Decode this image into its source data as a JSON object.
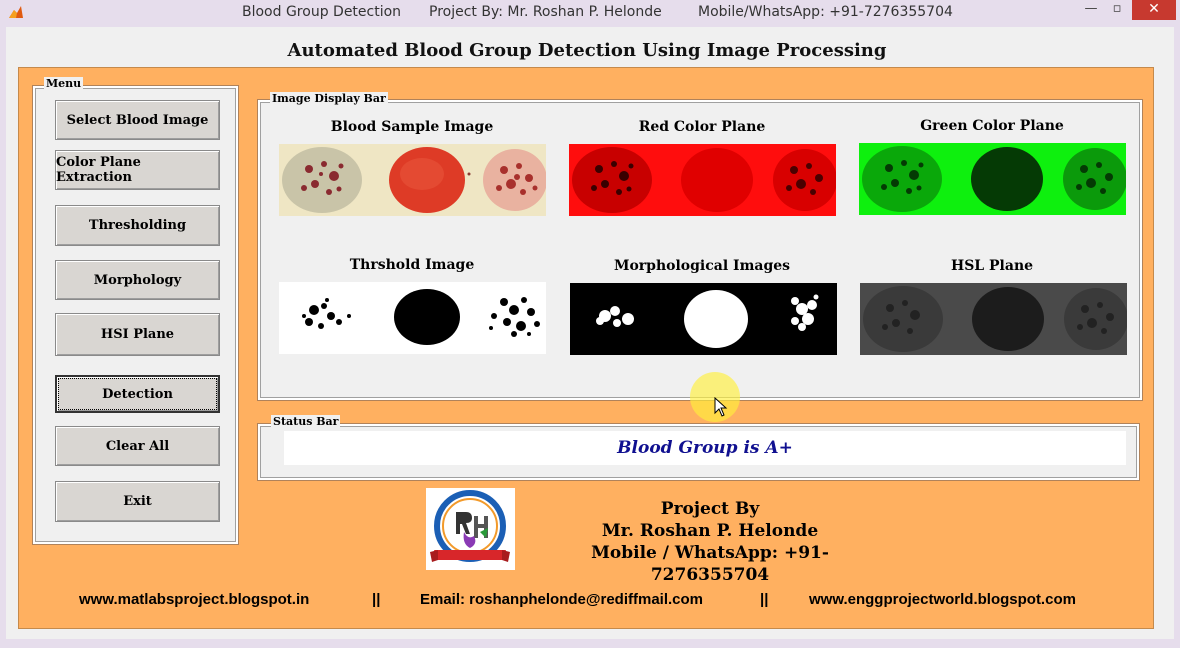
{
  "window": {
    "title": "Blood Group Detection",
    "project_by": "Project By: Mr. Roshan P. Helonde",
    "contact": "Mobile/WhatsApp: +91-7276355704",
    "minimize": "—",
    "maximize": "▫",
    "close": "✕"
  },
  "main_title": "Automated Blood Group Detection Using Image Processing",
  "menu": {
    "legend": "Menu",
    "buttons": [
      "Select Blood Image",
      "Color Plane Extraction",
      "Thresholding",
      "Morphology",
      "HSI Plane",
      "Detection",
      "Clear All",
      "Exit"
    ]
  },
  "image_display": {
    "legend": "Image Display Bar",
    "images": [
      {
        "caption": "Blood Sample Image",
        "icon": "blood-sample-image"
      },
      {
        "caption": "Red Color Plane",
        "icon": "red-plane-image"
      },
      {
        "caption": "Green Color Plane",
        "icon": "green-plane-image"
      },
      {
        "caption": "Thrshold Image",
        "icon": "threshold-image"
      },
      {
        "caption": "Morphological Images",
        "icon": "morphological-image"
      },
      {
        "caption": "HSL Plane",
        "icon": "hsl-plane-image"
      }
    ]
  },
  "status": {
    "legend": "Status Bar",
    "text": "Blood Group is A+"
  },
  "credits": {
    "line1": "Project By",
    "line2": "Mr. Roshan P. Helonde",
    "line3": "Mobile / WhatsApp: +91-7276355704"
  },
  "footer": {
    "blog": "www.matlabsproject.blogspot.in",
    "sep1": "||",
    "email": "Email:  roshanphelonde@rediffmail.com",
    "sep2": "||",
    "site": "www.enggprojectworld.blogspot.com"
  },
  "colors": {
    "panel_orange": "#ffb060",
    "status_text": "#101090",
    "close_button": "#c7392f"
  }
}
